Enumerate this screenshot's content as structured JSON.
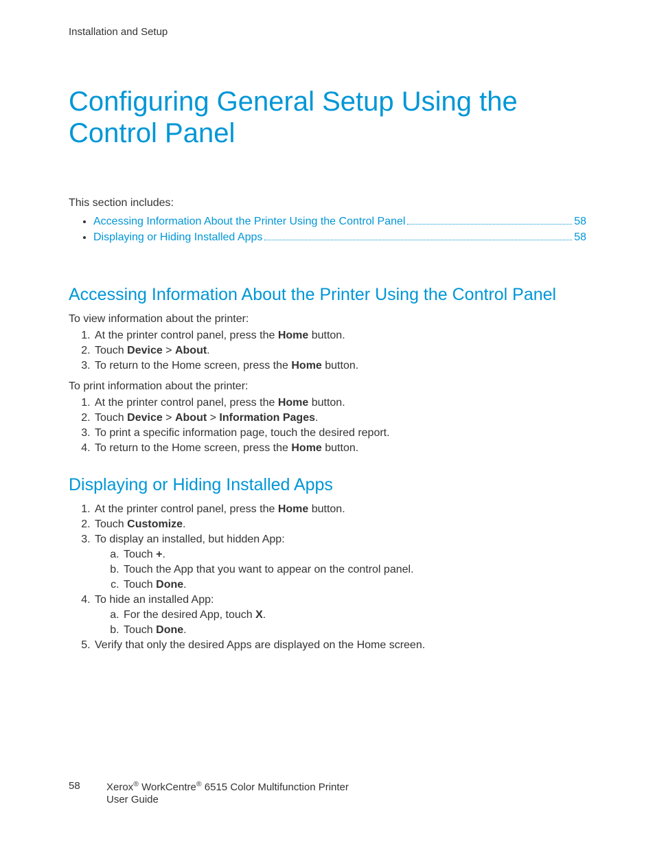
{
  "running_head": "Installation and Setup",
  "title": "Configuring General Setup Using the Control Panel",
  "intro": "This section includes:",
  "toc": [
    {
      "label": "Accessing Information About the Printer Using the Control Panel",
      "page": "58"
    },
    {
      "label": "Displaying or Hiding Installed Apps",
      "page": "58"
    }
  ],
  "section1": {
    "heading": "Accessing Information About the Printer Using the Control Panel",
    "p1": "To view information about the printer:",
    "steps1": {
      "s1_pre": "At the printer control panel, press the ",
      "s1_b": "Home",
      "s1_post": " button.",
      "s2_pre": "Touch ",
      "s2_b1": "Device",
      "s2_mid": " > ",
      "s2_b2": "About",
      "s2_post": ".",
      "s3_pre": "To return to the Home screen, press the ",
      "s3_b": "Home",
      "s3_post": " button."
    },
    "p2": "To print information about the printer:",
    "steps2": {
      "s1_pre": "At the printer control panel, press the ",
      "s1_b": "Home",
      "s1_post": " button.",
      "s2_pre": "Touch ",
      "s2_b1": "Device",
      "s2_m1": " > ",
      "s2_b2": "About",
      "s2_m2": " > ",
      "s2_b3": "Information Pages",
      "s2_post": ".",
      "s3": "To print a specific information page, touch the desired report.",
      "s4_pre": "To return to the Home screen, press the ",
      "s4_b": "Home",
      "s4_post": " button."
    }
  },
  "section2": {
    "heading": "Displaying or Hiding Installed Apps",
    "steps": {
      "s1_pre": "At the printer control panel, press the ",
      "s1_b": "Home",
      "s1_post": " button.",
      "s2_pre": "Touch ",
      "s2_b": "Customize",
      "s2_post": ".",
      "s3": "To display an installed, but hidden App:",
      "s3a_pre": "Touch ",
      "s3a_b": "+",
      "s3a_post": ".",
      "s3b": "Touch the App that you want to appear on the control panel.",
      "s3c_pre": "Touch ",
      "s3c_b": "Done",
      "s3c_post": ".",
      "s4": "To hide an installed App:",
      "s4a_pre": "For the desired App, touch ",
      "s4a_b": "X",
      "s4a_post": ".",
      "s4b_pre": "Touch ",
      "s4b_b": "Done",
      "s4b_post": ".",
      "s5": "Verify that only the desired Apps are displayed on the Home screen."
    }
  },
  "footer": {
    "page": "58",
    "brand1": "Xerox",
    "brand2": "WorkCentre",
    "model_rest": " 6515 Color Multifunction Printer",
    "line2": "User Guide",
    "reg": "®"
  }
}
